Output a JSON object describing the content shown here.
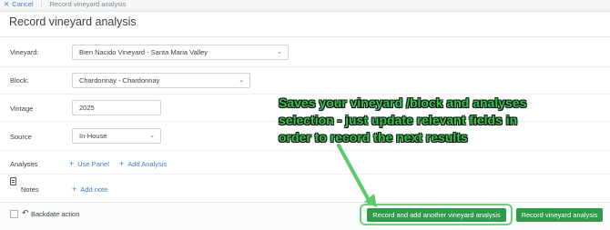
{
  "topbar": {
    "cancel_label": "Cancel",
    "breadcrumb": "Record vineyard analysis"
  },
  "page": {
    "title": "Record vineyard analysis"
  },
  "form": {
    "vineyard": {
      "label": "Vineyard:",
      "value": "Bien Nacido Vineyard - Santa Maria Valley"
    },
    "block": {
      "label": "Block:",
      "value": "Chardonnay - Chardonnay"
    },
    "vintage": {
      "label": "Vintage",
      "value": "2025"
    },
    "source": {
      "label": "Source",
      "value": "In-House"
    },
    "analyses": {
      "label": "Analyses",
      "use_panel": "Use Panel",
      "add_analysis": "Add Analysis"
    },
    "notes": {
      "label": "Notes",
      "add_note": "Add note"
    }
  },
  "footer": {
    "backdate_label": "Backdate action",
    "record_another_label": "Record and add another vineyard analysis",
    "record_label": "Record vineyard analysis"
  },
  "annotation": {
    "text": "Saves your vineyard /block and analyses selection - just update relevant fields in order to record the next results"
  },
  "colors": {
    "accent": "#3b7fc4",
    "primary_button": "#2d9b49",
    "annotation_text": "#2fc84a",
    "highlight": "#6fd07a"
  },
  "icons": [
    "close-icon",
    "chevron-down-icon",
    "plus-icon",
    "notes-icon",
    "undo-icon",
    "arrow-icon"
  ]
}
